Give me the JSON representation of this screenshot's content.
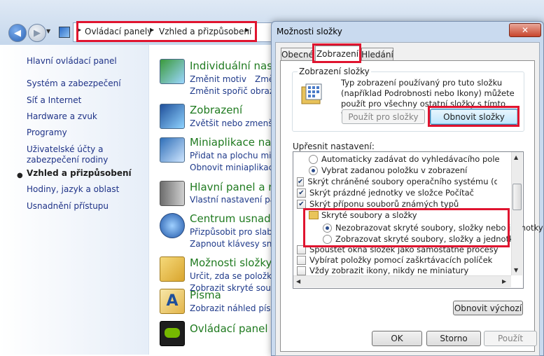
{
  "explorer": {
    "breadcrumbs": [
      "Ovládací panely",
      "Vzhled a přizpůsobení"
    ],
    "left_nav": [
      {
        "label": "Hlavní ovládací panel",
        "active": false
      },
      {
        "label": "Systém a zabezpečení",
        "active": false
      },
      {
        "label": "Síť a Internet",
        "active": false
      },
      {
        "label": "Hardware a zvuk",
        "active": false
      },
      {
        "label": "Programy",
        "active": false
      },
      {
        "label": "Uživatelské účty a zabezpečení rodiny",
        "active": false
      },
      {
        "label": "Vzhled a přizpůsobení",
        "active": true
      },
      {
        "label": "Hodiny, jazyk a oblast",
        "active": false
      },
      {
        "label": "Usnadnění přístupu",
        "active": false
      }
    ],
    "categories": [
      {
        "title": "Individuální nasta",
        "links": [
          "Změnit motiv",
          "Změ",
          "Změnit spořič obrazov"
        ]
      },
      {
        "title": "Zobrazení",
        "links": [
          "Zvětšit nebo zmenšit t"
        ]
      },
      {
        "title": "Miniaplikace na pl",
        "links": [
          "Přidat na plochu minia",
          "Obnovit miniaplikace n"
        ]
      },
      {
        "title": "Hlavní panel a na",
        "links": [
          "Vlastní nastavení pane"
        ]
      },
      {
        "title": "Centrum usnadn",
        "links": [
          "Přizpůsobit pro slabý z",
          "Zapnout klávesy snadr"
        ]
      },
      {
        "title": "Možnosti složky",
        "links": [
          "Určit, zda se položky o",
          "Zobrazit skryté soubo"
        ]
      },
      {
        "title": "Písma",
        "links": [
          "Zobrazit náhled písem"
        ]
      },
      {
        "title": "Ovládací panel N",
        "links": []
      }
    ]
  },
  "dialog": {
    "title": "Možnosti složky",
    "close_symbol": "✕",
    "tabs": [
      "Obecné",
      "Zobrazení",
      "Hledání"
    ],
    "active_tab": "Zobrazení",
    "folder_views": {
      "label": "Zobrazení složky",
      "description": "Typ zobrazení používaný pro tuto složku (například Podrobnosti nebo Ikony) můžete použít pro všechny ostatní složky s tímto typem souborů.",
      "apply_button": "Použít pro složky",
      "reset_button": "Obnovit složky"
    },
    "advanced": {
      "label": "Upřesnit nastavení:",
      "items": [
        {
          "kind": "radio",
          "checked": false,
          "label": "Automaticky zadávat do vyhledávacího pole"
        },
        {
          "kind": "radio",
          "checked": true,
          "label": "Vybrat zadanou položku v zobrazení"
        },
        {
          "kind": "checkbox",
          "checked": true,
          "label": "Skrýt chráněné soubory operačního systému (doporučeno)"
        },
        {
          "kind": "checkbox",
          "checked": true,
          "label": "Skrýt prázdné jednotky ve složce Počítač"
        },
        {
          "kind": "checkbox",
          "checked": true,
          "label": "Skrýt příponu souborů známých typů"
        },
        {
          "kind": "folder",
          "checked": false,
          "label": "Skryté soubory a složky"
        },
        {
          "kind": "radio",
          "checked": true,
          "label": "Nezobrazovat skryté soubory, složky nebo jednotky"
        },
        {
          "kind": "radio",
          "checked": false,
          "label": "Zobrazovat skryté soubory, složky a jednotky"
        },
        {
          "kind": "checkbox",
          "checked": false,
          "label": "Spouštět okna složek jako samostatné procesy"
        },
        {
          "kind": "checkbox",
          "checked": false,
          "label": "Vybírat položky pomocí zaškrtávacích políček"
        },
        {
          "kind": "checkbox",
          "checked": false,
          "label": "Vždy zobrazit ikony, nikdy ne miniatury"
        }
      ]
    },
    "restore_defaults_button": "Obnovit výchozí",
    "ok_button": "OK",
    "cancel_button": "Storno",
    "apply_button": "Použít"
  },
  "colors": {
    "highlight_red": "#e0142f",
    "link_blue": "#1f3a8a",
    "category_green": "#1f7a1f"
  }
}
